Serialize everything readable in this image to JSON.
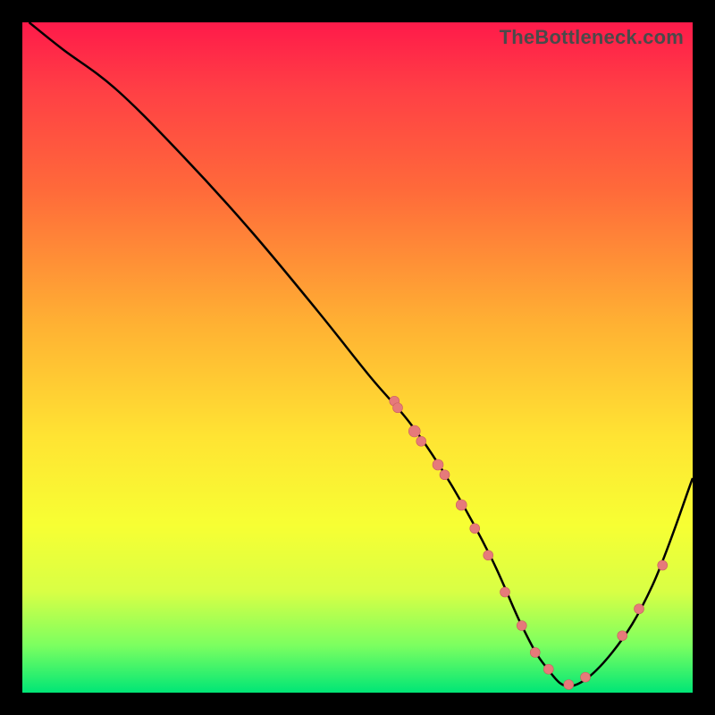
{
  "attribution": "TheBottleneck.com",
  "chart_data": {
    "type": "line",
    "title": "",
    "xlabel": "",
    "ylabel": "",
    "xlim": [
      0,
      100
    ],
    "ylim": [
      0,
      100
    ],
    "series": [
      {
        "name": "curve",
        "x": [
          1,
          6,
          14,
          24,
          34,
          44,
          52,
          58,
          64,
          70,
          74.5,
          78,
          82,
          88,
          94,
          100
        ],
        "y": [
          100,
          96,
          90,
          80,
          69,
          57,
          47,
          40,
          31,
          20,
          10,
          4,
          1,
          6,
          16,
          32
        ]
      }
    ],
    "markers": [
      {
        "x": 55.5,
        "y": 43.5,
        "r": 5.5
      },
      {
        "x": 56.0,
        "y": 42.5,
        "r": 5.5
      },
      {
        "x": 58.5,
        "y": 39.0,
        "r": 6.5
      },
      {
        "x": 59.5,
        "y": 37.5,
        "r": 5.5
      },
      {
        "x": 62.0,
        "y": 34.0,
        "r": 6.0
      },
      {
        "x": 63.0,
        "y": 32.5,
        "r": 5.5
      },
      {
        "x": 65.5,
        "y": 28.0,
        "r": 6.0
      },
      {
        "x": 67.5,
        "y": 24.5,
        "r": 5.5
      },
      {
        "x": 69.5,
        "y": 20.5,
        "r": 5.5
      },
      {
        "x": 72.0,
        "y": 15.0,
        "r": 5.5
      },
      {
        "x": 74.5,
        "y": 10.0,
        "r": 5.5
      },
      {
        "x": 76.5,
        "y": 6.0,
        "r": 5.5
      },
      {
        "x": 78.5,
        "y": 3.5,
        "r": 5.5
      },
      {
        "x": 81.5,
        "y": 1.2,
        "r": 5.5
      },
      {
        "x": 84.0,
        "y": 2.3,
        "r": 5.5
      },
      {
        "x": 89.5,
        "y": 8.5,
        "r": 5.5
      },
      {
        "x": 92.0,
        "y": 12.5,
        "r": 5.5
      },
      {
        "x": 95.5,
        "y": 19.0,
        "r": 5.5
      }
    ],
    "colors": {
      "line": "#000000",
      "marker_fill": "#e67a7a",
      "marker_stroke": "#c95f5f"
    }
  }
}
